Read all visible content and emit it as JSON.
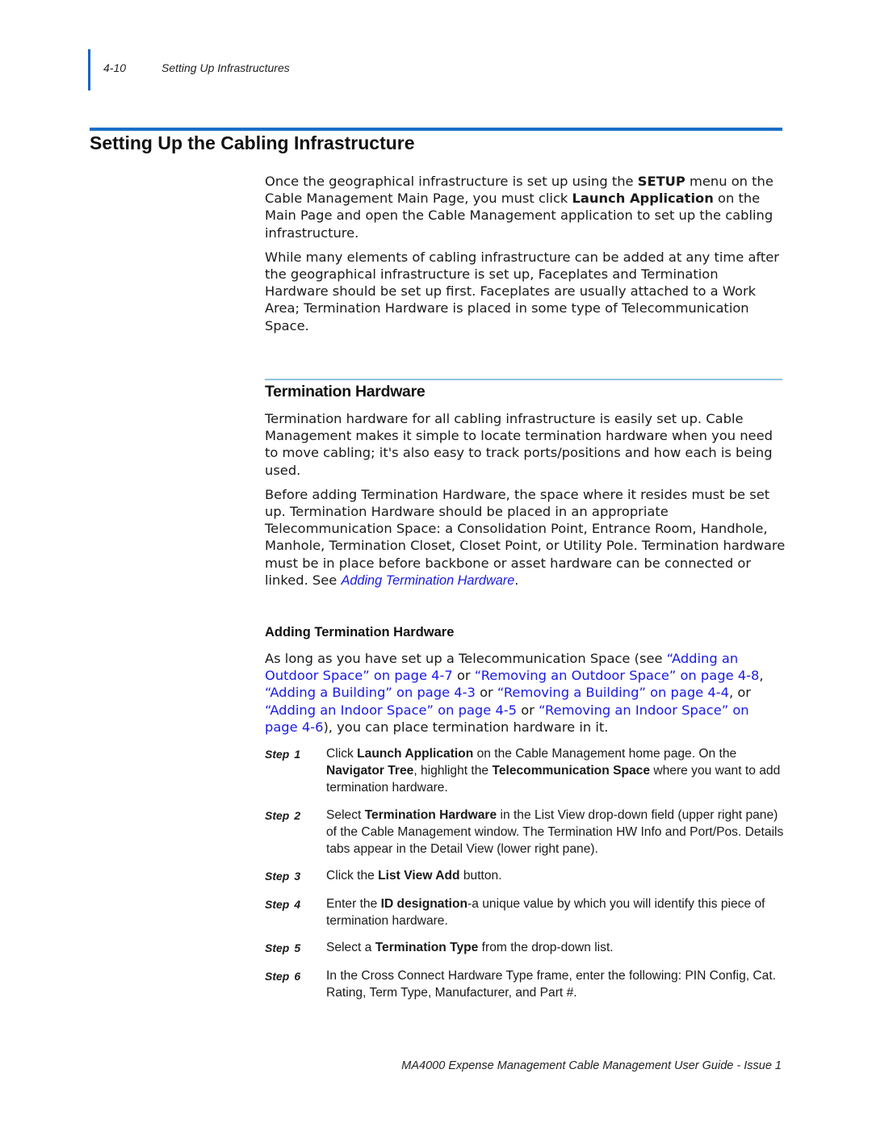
{
  "header": {
    "page_number": "4-10",
    "section": "Setting Up Infrastructures"
  },
  "title": "Setting Up the Cabling Infrastructure",
  "intro": {
    "p1": {
      "t1": "Once the geographical infrastructure is set up using the ",
      "b1": "SETUP",
      "t2": " menu on the Cable Management Main Page, you must click ",
      "b2": "Launch Application",
      "t3": " on the Main Page and open the Cable Management application to set up the cabling infrastructure."
    },
    "p2": "While many elements of cabling infrastructure can be added at any time after the geographical infrastructure is set up, Faceplates and Termination Hardware should be set up first. Faceplates are usually attached to a Work Area; Termination Hardware is placed in some type of Telecommunication Space."
  },
  "termination": {
    "heading": "Termination Hardware",
    "p1": "Termination hardware for all cabling infrastructure is easily set up. Cable Management makes it simple to locate termination hardware when you need to move cabling; it's also easy to track ports/positions and how each is being used.",
    "p2": {
      "text": "Before adding Termination Hardware, the space where it resides must be set up. Termination Hardware should be placed in an appropriate Telecommunication Space: a Consolidation Point, Entrance Room, Handhole, Manhole, Termination Closet, Closet Point, or Utility Pole. Termination hardware must be in place before backbone or asset hardware can be connected or linked. See ",
      "link": "Adding Termination Hardware",
      "end": "."
    }
  },
  "adding": {
    "heading": "Adding Termination Hardware",
    "intro": {
      "t1": "As long as you have set up a Telecommunication Space (see ",
      "l1": "“Adding an Outdoor Space” on page 4-7",
      "t2": " or ",
      "l2": "“Removing an Outdoor Space” on page 4-8",
      "t3": ", ",
      "l3": "“Adding a Building” on page 4-3",
      "t4": " or ",
      "l4": "“Removing a Building” on page 4-4",
      "t5": ", or ",
      "l5": "“Adding an Indoor Space” on page 4-5",
      "t6": " or ",
      "l6": "“Removing an Indoor Space” on page 4-6",
      "t7": "), you can place termination hardware in it."
    },
    "step_word": "Step",
    "steps": [
      {
        "num": "1",
        "parts": [
          "Click ",
          "Launch Application",
          " on the Cable Management home page. On the ",
          "Navigator Tree",
          ", highlight the ",
          "Telecommunication Space",
          " where you want to add termination hardware."
        ]
      },
      {
        "num": "2",
        "parts": [
          "Select ",
          "Termination Hardware",
          " in the List View drop-down field (upper right pane) of the Cable Management window. The Termination HW Info and Port/Pos. Details tabs appear in the Detail View (lower right pane)."
        ]
      },
      {
        "num": "3",
        "parts": [
          "Click the ",
          "List View Add",
          " button."
        ]
      },
      {
        "num": "4",
        "parts": [
          "Enter the ",
          "ID designation",
          "-a unique value by which you will identify this piece of termination hardware."
        ]
      },
      {
        "num": "5",
        "parts": [
          "Select a ",
          "Termination Type",
          " from the drop-down list."
        ]
      },
      {
        "num": "6",
        "parts": [
          "In the Cross Connect Hardware Type frame, enter the following: PIN Config, Cat. Rating, Term Type, Manufacturer, and Part #."
        ]
      }
    ]
  },
  "footer": "MA4000 Expense Management Cable Management User Guide - Issue 1",
  "colors": {
    "accent": "#1a6fc7",
    "sub_rule": "#8fc3e0",
    "link": "#1a1ae6"
  }
}
